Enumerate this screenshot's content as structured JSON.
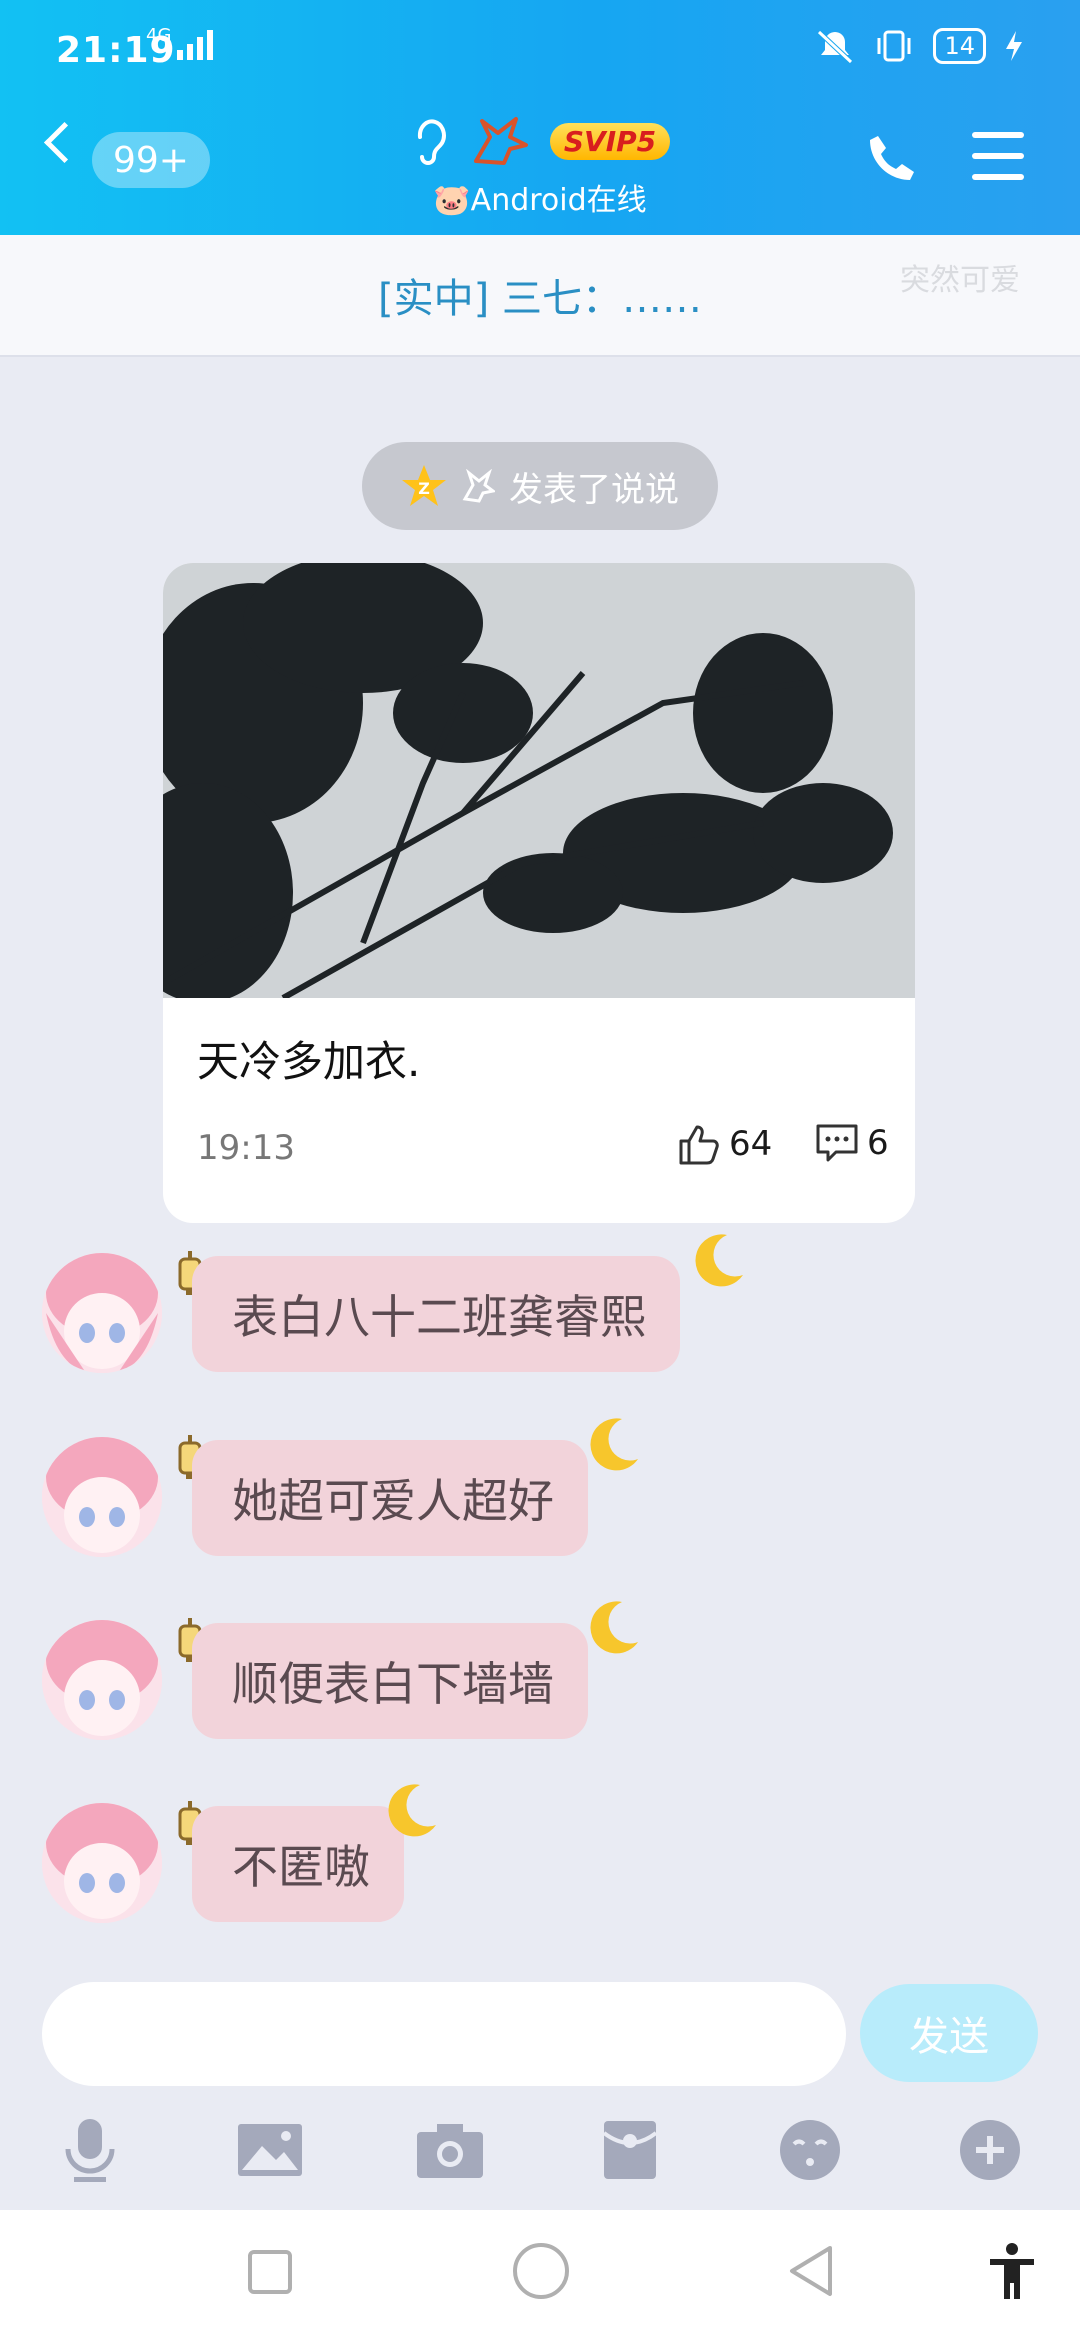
{
  "status_bar": {
    "time": "21:19",
    "network": "4G",
    "battery": "14",
    "icons": [
      "mute-icon",
      "vibrate-icon",
      "battery-icon",
      "charging-icon"
    ]
  },
  "header": {
    "unread_badge": "99+",
    "vip_badge": "SVIP5",
    "subtitle": "🐷Android在线",
    "icons": [
      "back-icon",
      "ear-icon",
      "unicorn-icon",
      "phone-icon",
      "menu-icon"
    ]
  },
  "notice": {
    "text": "[实中] 三七：……",
    "watermark": "突然可爱"
  },
  "feed_notice": {
    "text": "发表了说说"
  },
  "post_card": {
    "text": "天冷多加衣.",
    "time": "19:13",
    "likes": "64",
    "comments": "6"
  },
  "messages": [
    {
      "text": "表白八十二班龚睿熙"
    },
    {
      "text": "她超可爱人超好"
    },
    {
      "text": "顺便表白下墙墙"
    },
    {
      "text": "不匿嗷"
    }
  ],
  "composer": {
    "placeholder": "",
    "send_label": "发送"
  },
  "toolbar": [
    "mic-icon",
    "image-icon",
    "camera-icon",
    "red-packet-icon",
    "emoji-icon",
    "plus-icon"
  ],
  "nav": [
    "recent-apps-icon",
    "home-icon",
    "back-nav-icon",
    "accessibility-icon"
  ],
  "colors": {
    "header_start": "#12c1f3",
    "header_end": "#2aa0f0",
    "bubble": "#f2d3da",
    "send_button": "#b8ecfb",
    "notice_text": "#2a8fc4"
  }
}
